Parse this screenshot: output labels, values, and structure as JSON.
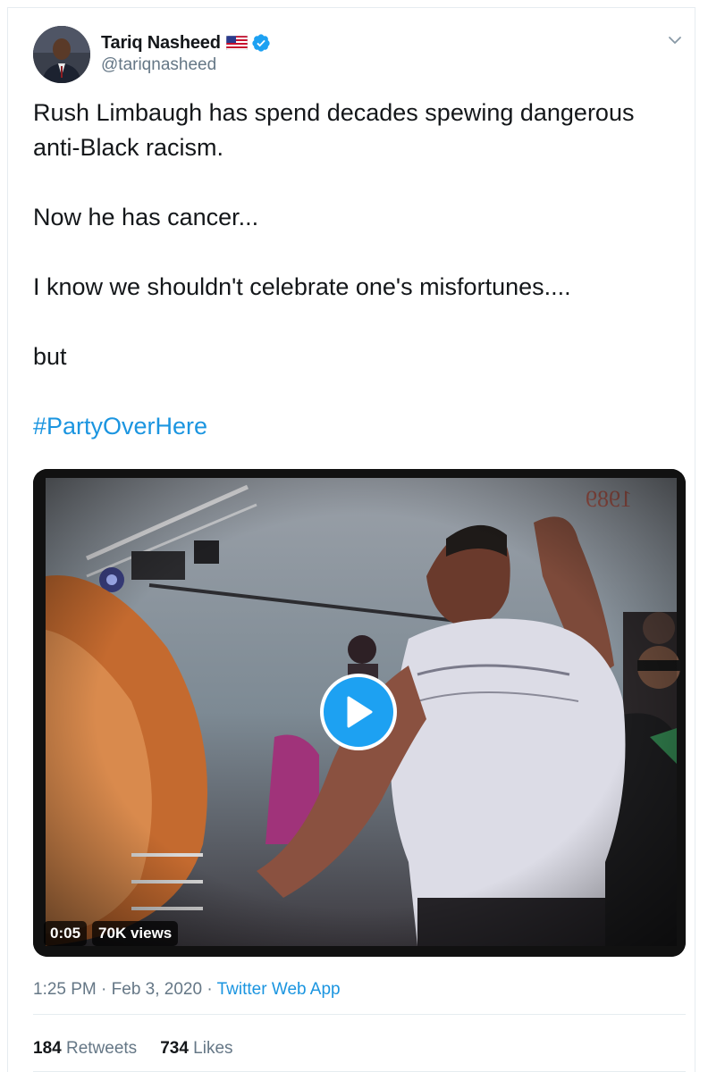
{
  "author": {
    "display_name": "Tariq Nasheed",
    "handle": "@tariqnasheed",
    "flag": "flag-us-icon",
    "verified": "verified-badge-icon"
  },
  "tweet": {
    "lines": [
      "Rush Limbaugh has spend decades spewing dangerous",
      "anti-Black racism.",
      "Now he has cancer...",
      "I know we shouldn't celebrate one's misfortunes....",
      "but"
    ],
    "hashtag": "#PartyOverHere"
  },
  "media": {
    "type": "video",
    "overlay_year": "1989",
    "duration": "0:05",
    "views": "70K views",
    "play_icon": "play-icon"
  },
  "meta": {
    "time": "1:25 PM",
    "separator": "·",
    "date": "Feb 3, 2020",
    "source": "Twitter Web App"
  },
  "stats": {
    "retweets_count": "184",
    "retweets_label": "Retweets",
    "likes_count": "734",
    "likes_label": "Likes"
  },
  "colors": {
    "link": "#1b95e0",
    "verified": "#1da1f2",
    "text": "#14171a",
    "secondary": "#657786"
  }
}
